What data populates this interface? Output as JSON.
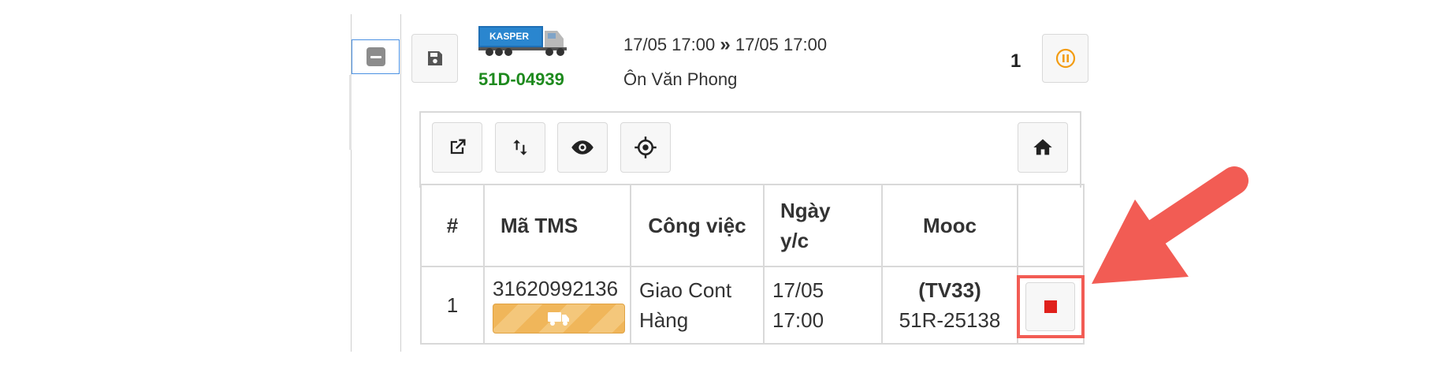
{
  "vehicle": {
    "logo_text": "KASPER",
    "plate": "51D-04939",
    "schedule_start": "17/05 17:00",
    "schedule_end": "17/05 17:00",
    "driver": "Ôn Văn Phong",
    "count": "1"
  },
  "table": {
    "headers": [
      "#",
      "Mã TMS",
      "Công việc",
      "Ngày\ny/c",
      "Mooc",
      ""
    ],
    "rows": [
      {
        "index": "1",
        "tms_code": "31620992136",
        "job": "Giao Cont Hàng",
        "date": "17/05",
        "time": "17:00",
        "mooc_code": "(TV33)",
        "mooc_plate": "51R-25138"
      }
    ]
  },
  "colors": {
    "plate": "#1e8a1e",
    "pause_icon": "#f39c12",
    "badge": "#f0b65a",
    "stop": "#e0201b",
    "highlight_box": "#f25c54",
    "arrow": "#f25c54"
  },
  "icons": [
    "collapse-icon",
    "save-icon",
    "pause-icon",
    "external-link-icon",
    "swap-icon",
    "eye-icon",
    "locate-icon",
    "home-icon",
    "truck-icon",
    "stop-icon",
    "arrow-annotation"
  ]
}
